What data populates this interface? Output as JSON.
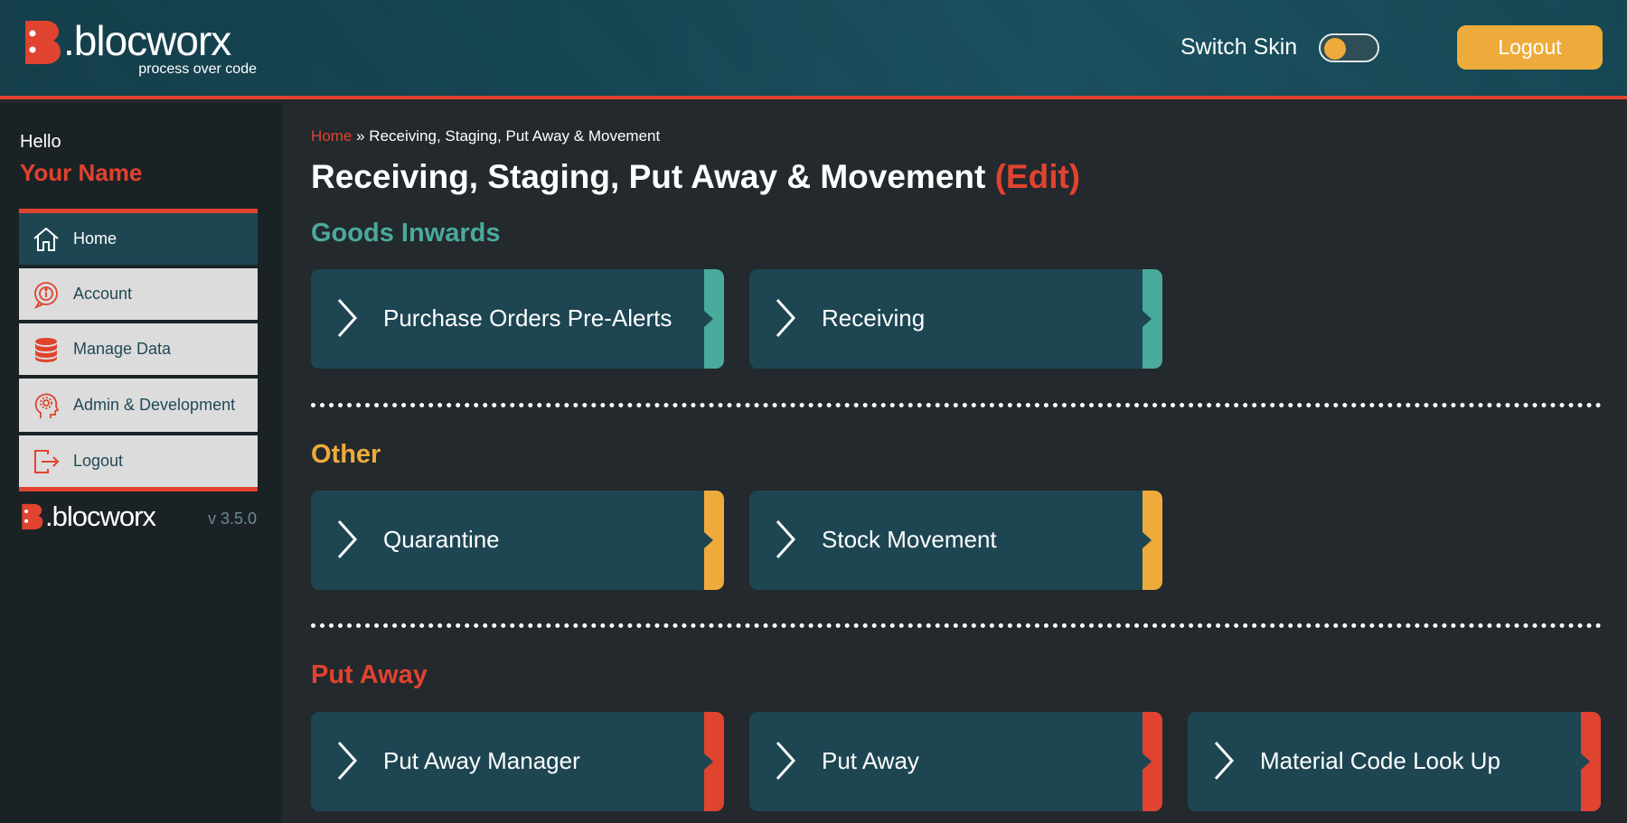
{
  "header": {
    "logo_text": ".blocworx",
    "logo_tagline": "process over code",
    "switch_skin_label": "Switch Skin",
    "logout_label": "Logout"
  },
  "sidebar": {
    "hello": "Hello",
    "username": "Your Name",
    "items": [
      {
        "label": "Home",
        "icon": "home-icon",
        "active": true
      },
      {
        "label": "Account",
        "icon": "account-info-icon"
      },
      {
        "label": "Manage Data",
        "icon": "database-icon"
      },
      {
        "label": "Admin & Development",
        "icon": "admin-gear-head-icon"
      },
      {
        "label": "Logout",
        "icon": "logout-icon"
      }
    ],
    "footer_logo_text": ".blocworx",
    "version": "v 3.5.0"
  },
  "main": {
    "breadcrumb_home": "Home",
    "breadcrumb_separator": "»",
    "breadcrumb_current": "Receiving, Staging, Put Away & Movement",
    "title": "Receiving, Staging, Put Away & Movement",
    "title_edit": "(Edit)",
    "sections": [
      {
        "title": "Goods Inwards",
        "color": "#4aaa9c",
        "tiles": [
          "Purchase Orders Pre-Alerts",
          "Receiving"
        ]
      },
      {
        "title": "Other",
        "color": "#eeab3b",
        "tiles": [
          "Quarantine",
          "Stock Movement"
        ]
      },
      {
        "title": "Put Away",
        "color": "#e0432f",
        "tiles": [
          "Put Away Manager",
          "Put Away",
          "Material Code Look Up"
        ]
      }
    ]
  },
  "colors": {
    "accent_red": "#e0432f",
    "accent_orange": "#eeab3b",
    "accent_teal": "#4aaa9c",
    "tile_bg": "#1d4652",
    "page_bg": "#23292d"
  }
}
